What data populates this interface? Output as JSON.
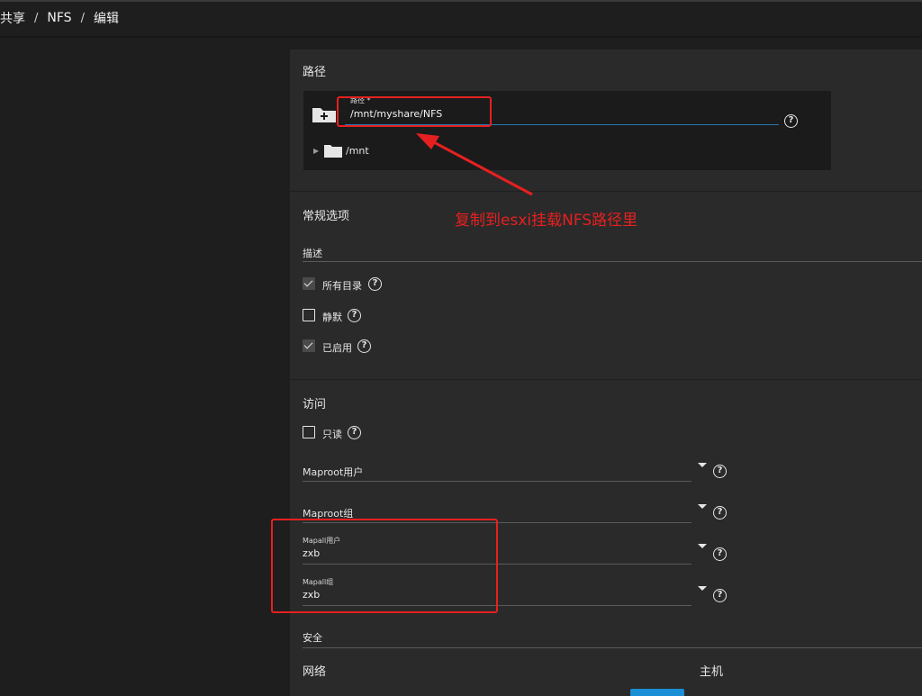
{
  "breadcrumb": {
    "items": [
      "共享",
      "NFS",
      "编辑"
    ],
    "separator": "/"
  },
  "path_section": {
    "title": "路径",
    "field_label": "路径 *",
    "field_value": "/mnt/myshare/NFS",
    "tree_root": "/mnt"
  },
  "general_section": {
    "title": "常规选项",
    "description_label": "描述",
    "options": [
      {
        "label": "所有目录",
        "checked": true
      },
      {
        "label": "静默",
        "checked": false
      },
      {
        "label": "已启用",
        "checked": true
      }
    ]
  },
  "access_section": {
    "title": "访问",
    "readonly_label": "只读",
    "readonly_checked": false,
    "maproot_user_label": "Maproot用户",
    "maproot_group_label": "Maproot组",
    "mapall_user_label": "Mapall用户",
    "mapall_user_value": "zxb",
    "mapall_group_label": "Mapall组",
    "mapall_group_value": "zxb"
  },
  "security_section": {
    "title": "安全"
  },
  "network_label": "网络",
  "host_label": "主机",
  "annotation_text": "复制到esxi挂载NFS路径里",
  "colors": {
    "annotation": "#e62020",
    "accent": "#2a7ab5",
    "button": "#1a8fd6",
    "panel": "#2a2a2a"
  }
}
